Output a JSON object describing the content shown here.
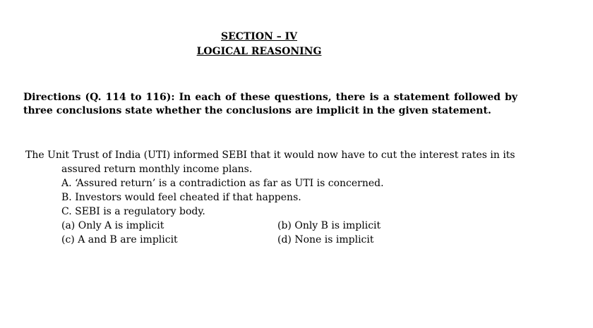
{
  "section": {
    "title": "SECTION – IV",
    "subtitle": "LOGICAL REASONING"
  },
  "directions": "Directions (Q. 114 to 116): In each of these questions, there is a statement followed by three conclusions state whether the conclusions are implicit in the given statement.",
  "question": {
    "statement": "The Unit Trust of India (UTI) informed SEBI that it would now have to cut the interest rates in its assured return monthly income plans.",
    "conclusions": [
      "A. ‘Assured return’ is a contradiction as far as UTI is concerned.",
      "B. Investors would feel cheated if that happens.",
      "C. SEBI is a regulatory body."
    ],
    "options": [
      "(a) Only A is implicit",
      "(b) Only B is implicit",
      "(c) A and B are implicit",
      "(d) None is implicit"
    ]
  }
}
